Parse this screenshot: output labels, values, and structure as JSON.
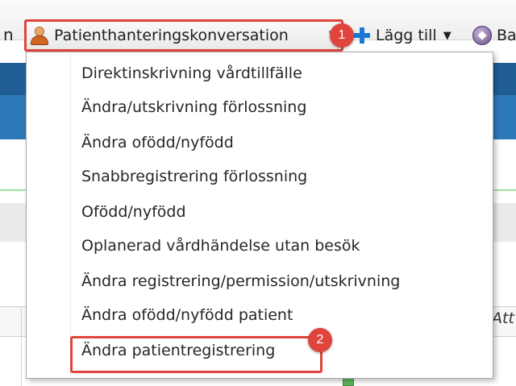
{
  "toolbar": {
    "left_stub": "n",
    "patient_conversation_label": "Patienthanteringskonversation",
    "add_label": "Lägg till",
    "third_label": "Ba"
  },
  "menu": {
    "items": [
      "Direktinskrivning vårdtillfälle",
      "Ändra/utskrivning förlossning",
      "Ändra ofödd/nyfödd",
      "Snabbregistrering förlossning",
      "Ofödd/nyfödd",
      "Oplanerad vårdhändelse utan besök",
      "Ändra registrering/permission/utskrivning",
      "Ändra ofödd/nyfödd patient",
      "Ändra patientregistrering"
    ]
  },
  "table": {
    "partial_header": "Att"
  },
  "callouts": [
    "1",
    "2"
  ],
  "colors": {
    "highlight": "#e0443c",
    "header_dark": "#1f5d94",
    "header_mid": "#2d78b8"
  }
}
